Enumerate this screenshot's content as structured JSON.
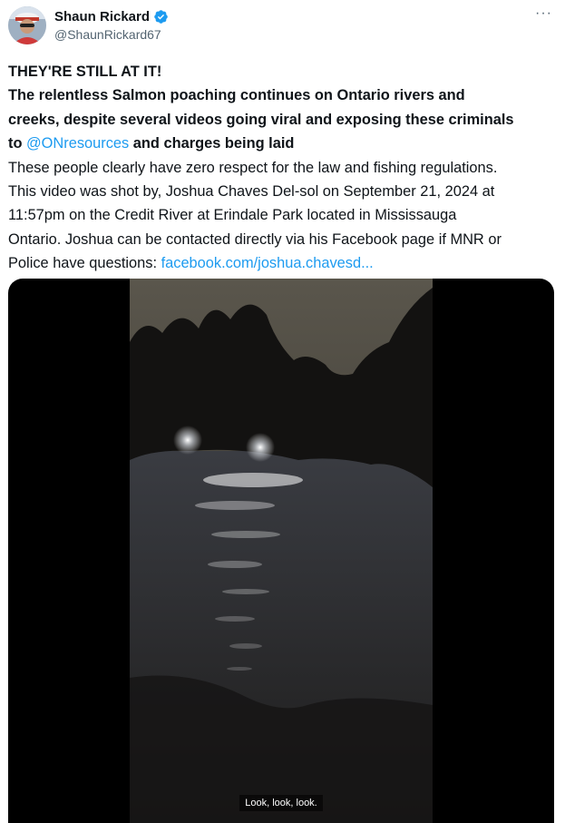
{
  "author": {
    "name": "Shaun Rickard",
    "handle": "@ShaunRickard67",
    "verified": true,
    "avatar_icon": "user-avatar"
  },
  "menu": {
    "more_label": "···"
  },
  "post": {
    "headline": "THEY'RE STILL AT IT!",
    "bold_line_1": "The relentless Salmon poaching continues on Ontario rivers and",
    "bold_line_2": "creeks, despite several videos going viral and exposing these criminals",
    "bold_line_3_start": "to ",
    "mention": "@ONresources",
    "bold_line_3_end": " and charges being laid",
    "body_line_1": "These people clearly have zero respect for the law and fishing regulations.",
    "body_line_2": "This video was shot by, Joshua Chaves Del-sol on September 21, 2024 at",
    "body_line_3": "11:57pm on the Credit River at Erindale Park located in Mississauga",
    "body_line_4": "Ontario. Joshua can be contacted directly via his Facebook page if MNR or",
    "body_line_5_start": "Police have questions: ",
    "link": "facebook.com/joshua.chavesd..."
  },
  "video": {
    "caption": "Look, look, look."
  },
  "colors": {
    "accent": "#1d9bf0",
    "text": "#0f1419",
    "secondary": "#536471",
    "media_bg": "#000000"
  }
}
